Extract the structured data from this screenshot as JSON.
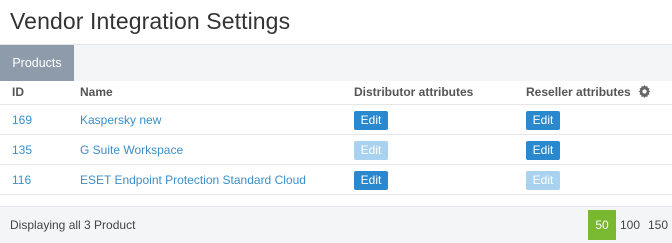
{
  "page": {
    "title": "Vendor Integration Settings"
  },
  "tabs": [
    {
      "label": "Products",
      "active": true
    }
  ],
  "table": {
    "headers": {
      "id": "ID",
      "name": "Name",
      "distributor": "Distributor attributes",
      "reseller": "Reseller attributes"
    },
    "rows": [
      {
        "id": "169",
        "name": "Kaspersky new",
        "distributor_edit": "Edit",
        "distributor_enabled": true,
        "reseller_edit": "Edit",
        "reseller_enabled": true
      },
      {
        "id": "135",
        "name": "G Suite Workspace",
        "distributor_edit": "Edit",
        "distributor_enabled": false,
        "reseller_edit": "Edit",
        "reseller_enabled": true
      },
      {
        "id": "116",
        "name": "ESET Endpoint Protection Standard Cloud",
        "distributor_edit": "Edit",
        "distributor_enabled": true,
        "reseller_edit": "Edit",
        "reseller_enabled": false
      }
    ]
  },
  "footer": {
    "status": "Displaying all 3 Product",
    "page_sizes": [
      "50",
      "100",
      "150"
    ],
    "active_page_size": "50"
  },
  "icons": {
    "settings": "gear-icon"
  },
  "colors": {
    "link": "#3a8fc9",
    "button": "#2a88cf",
    "button_disabled": "#a8d2ef",
    "tab_active": "#8e9bab",
    "page_size_active": "#79b932"
  }
}
